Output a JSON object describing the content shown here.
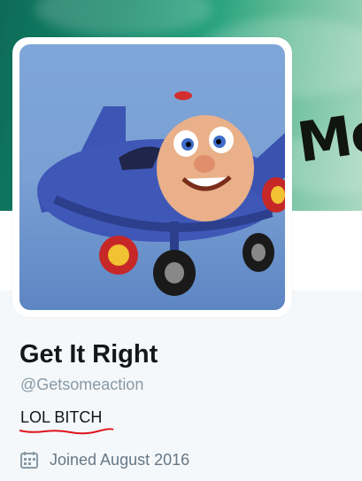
{
  "profile": {
    "display_name": "Get It Right",
    "handle": "@Getsomeaction",
    "bio": "LOL BITCH",
    "joined_text": "Joined August 2016"
  },
  "banner": {
    "visible_text": "Me"
  },
  "icons": {
    "joined": "calendar-icon"
  },
  "colors": {
    "name": "#14171a",
    "handle": "#8899a6",
    "secondary_text": "#657786",
    "spellcheck_underline": "#e0141e"
  }
}
